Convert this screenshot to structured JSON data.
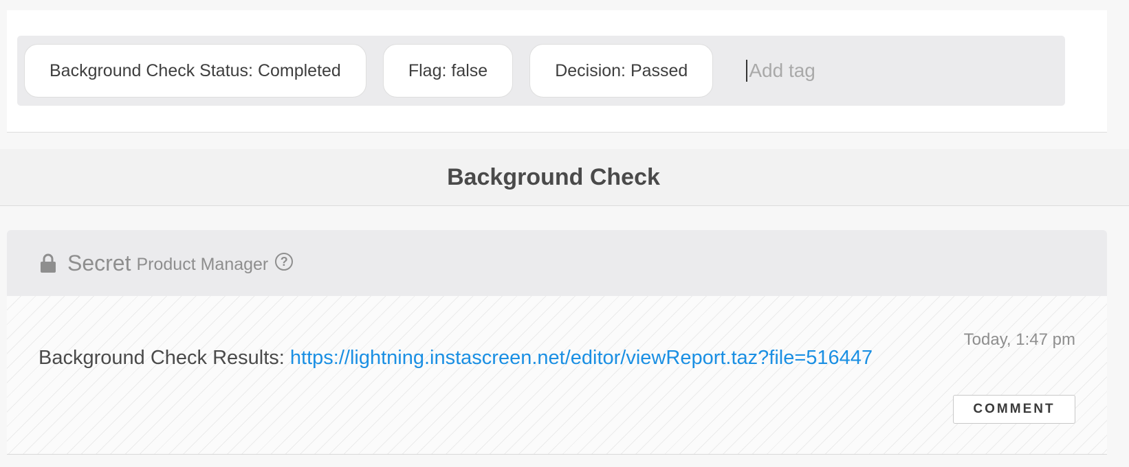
{
  "tags": {
    "items": [
      {
        "label": "Background Check Status: Completed"
      },
      {
        "label": "Flag: false"
      },
      {
        "label": "Decision: Passed"
      }
    ],
    "input_placeholder": "Add tag"
  },
  "section": {
    "title": "Background Check"
  },
  "secret_card": {
    "visibility_label": "Secret",
    "role_label": "Product Manager",
    "help_glyph": "?",
    "lock_icon": "lock-icon",
    "results_label": "Background Check Results:",
    "results_link": "https://lightning.instascreen.net/editor/viewReport.taz?file=516447",
    "timestamp": "Today, 1:47 pm",
    "comment_button": "COMMENT"
  },
  "colors": {
    "link": "#1a8fe3",
    "muted": "#8e8e8e"
  }
}
